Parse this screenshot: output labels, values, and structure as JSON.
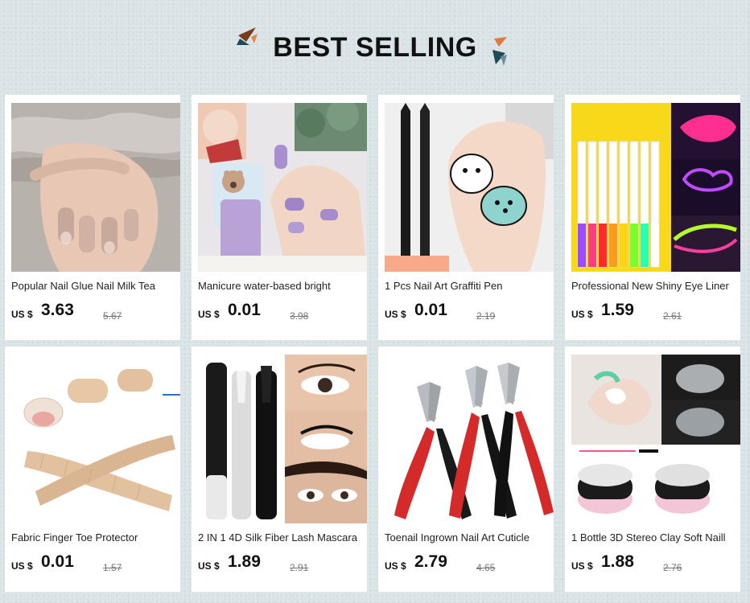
{
  "header": {
    "title": "BEST SELLING"
  },
  "colors": {
    "background": "#d9e3e6",
    "card": "#ffffff",
    "deco_brown": "#7a3a22",
    "deco_orange": "#e07a3a",
    "deco_teal": "#1f4a57"
  },
  "products": [
    {
      "name": "Popular Nail Glue Nail Milk Tea",
      "currency": "US $",
      "price": "3.63",
      "old_price": "5.67",
      "image": "nails-milk-tea"
    },
    {
      "name": "Manicure water-based bright",
      "currency": "US $",
      "price": "0.01",
      "old_price": "3.98",
      "image": "purple-nail-polish"
    },
    {
      "name": "1 Pcs Nail Art Graffiti Pen",
      "currency": "US $",
      "price": "0.01",
      "old_price": "2.19",
      "image": "graffiti-pen"
    },
    {
      "name": "Professional New Shiny Eye Liner",
      "currency": "US $",
      "price": "1.59",
      "old_price": "2.61",
      "image": "neon-eyeliner"
    },
    {
      "name": "Fabric Finger Toe Protector",
      "currency": "US $",
      "price": "0.01",
      "old_price": "1.57",
      "image": "toe-protector"
    },
    {
      "name": "2 IN 1 4D Silk Fiber Lash Mascara",
      "currency": "US $",
      "price": "1.89",
      "old_price": "2.91",
      "image": "lash-mascara"
    },
    {
      "name": "Toenail Ingrown Nail Art Cuticle",
      "currency": "US $",
      "price": "2.79",
      "old_price": "4.65",
      "image": "cuticle-nippers"
    },
    {
      "name": "1 Bottle 3D Stereo Clay Soft Naill",
      "currency": "US $",
      "price": "1.88",
      "old_price": "2.76",
      "image": "clay-gel"
    }
  ]
}
